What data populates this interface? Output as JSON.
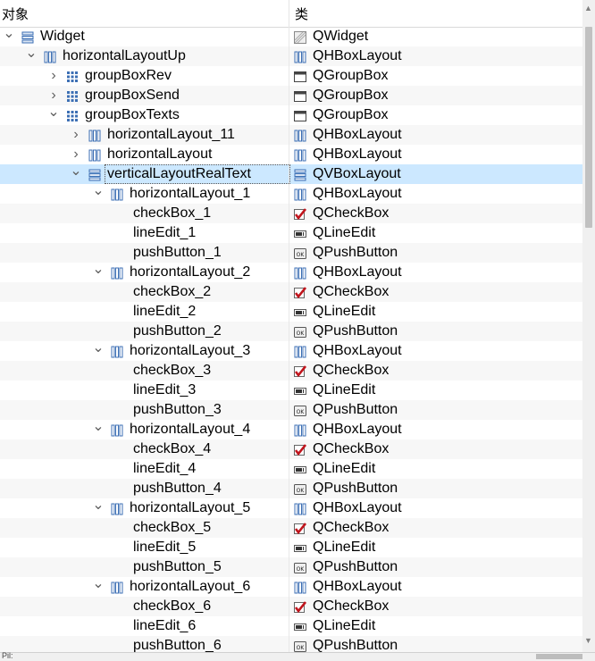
{
  "header": {
    "object_col": "对象",
    "class_col": "类"
  },
  "rows": [
    {
      "name": "Widget",
      "cls": "QWidget",
      "depth": 0,
      "exp": "open",
      "icon": "vbox-layout-icon",
      "cicon": "widget-icon"
    },
    {
      "name": "horizontalLayoutUp",
      "cls": "QHBoxLayout",
      "depth": 1,
      "exp": "open",
      "icon": "hbox-layout-icon",
      "cicon": "hbox-layout-icon"
    },
    {
      "name": "groupBoxRev",
      "cls": "QGroupBox",
      "depth": 2,
      "exp": "closed",
      "icon": "grid-layout-icon",
      "cicon": "groupbox-icon"
    },
    {
      "name": "groupBoxSend",
      "cls": "QGroupBox",
      "depth": 2,
      "exp": "closed",
      "icon": "grid-layout-icon",
      "cicon": "groupbox-icon"
    },
    {
      "name": "groupBoxTexts",
      "cls": "QGroupBox",
      "depth": 2,
      "exp": "open",
      "icon": "grid-layout-icon",
      "cicon": "groupbox-icon"
    },
    {
      "name": "horizontalLayout_11",
      "cls": "QHBoxLayout",
      "depth": 3,
      "exp": "closed",
      "icon": "hbox-layout-icon",
      "cicon": "hbox-layout-icon"
    },
    {
      "name": "horizontalLayout",
      "cls": "QHBoxLayout",
      "depth": 3,
      "exp": "closed",
      "icon": "hbox-layout-icon",
      "cicon": "hbox-layout-icon"
    },
    {
      "name": "verticalLayoutRealText",
      "cls": "QVBoxLayout",
      "depth": 3,
      "exp": "open",
      "icon": "vbox-layout-icon",
      "cicon": "vbox-layout-icon",
      "selected": true
    },
    {
      "name": "horizontalLayout_1",
      "cls": "QHBoxLayout",
      "depth": 4,
      "exp": "open",
      "icon": "hbox-layout-icon",
      "cicon": "hbox-layout-icon"
    },
    {
      "name": "checkBox_1",
      "cls": "QCheckBox",
      "depth": 5,
      "exp": "none",
      "icon": "",
      "cicon": "checkbox-icon"
    },
    {
      "name": "lineEdit_1",
      "cls": "QLineEdit",
      "depth": 5,
      "exp": "none",
      "icon": "",
      "cicon": "lineedit-icon"
    },
    {
      "name": "pushButton_1",
      "cls": "QPushButton",
      "depth": 5,
      "exp": "none",
      "icon": "",
      "cicon": "pushbutton-icon"
    },
    {
      "name": "horizontalLayout_2",
      "cls": "QHBoxLayout",
      "depth": 4,
      "exp": "open",
      "icon": "hbox-layout-icon",
      "cicon": "hbox-layout-icon"
    },
    {
      "name": "checkBox_2",
      "cls": "QCheckBox",
      "depth": 5,
      "exp": "none",
      "icon": "",
      "cicon": "checkbox-icon"
    },
    {
      "name": "lineEdit_2",
      "cls": "QLineEdit",
      "depth": 5,
      "exp": "none",
      "icon": "",
      "cicon": "lineedit-icon"
    },
    {
      "name": "pushButton_2",
      "cls": "QPushButton",
      "depth": 5,
      "exp": "none",
      "icon": "",
      "cicon": "pushbutton-icon"
    },
    {
      "name": "horizontalLayout_3",
      "cls": "QHBoxLayout",
      "depth": 4,
      "exp": "open",
      "icon": "hbox-layout-icon",
      "cicon": "hbox-layout-icon"
    },
    {
      "name": "checkBox_3",
      "cls": "QCheckBox",
      "depth": 5,
      "exp": "none",
      "icon": "",
      "cicon": "checkbox-icon"
    },
    {
      "name": "lineEdit_3",
      "cls": "QLineEdit",
      "depth": 5,
      "exp": "none",
      "icon": "",
      "cicon": "lineedit-icon"
    },
    {
      "name": "pushButton_3",
      "cls": "QPushButton",
      "depth": 5,
      "exp": "none",
      "icon": "",
      "cicon": "pushbutton-icon"
    },
    {
      "name": "horizontalLayout_4",
      "cls": "QHBoxLayout",
      "depth": 4,
      "exp": "open",
      "icon": "hbox-layout-icon",
      "cicon": "hbox-layout-icon"
    },
    {
      "name": "checkBox_4",
      "cls": "QCheckBox",
      "depth": 5,
      "exp": "none",
      "icon": "",
      "cicon": "checkbox-icon"
    },
    {
      "name": "lineEdit_4",
      "cls": "QLineEdit",
      "depth": 5,
      "exp": "none",
      "icon": "",
      "cicon": "lineedit-icon"
    },
    {
      "name": "pushButton_4",
      "cls": "QPushButton",
      "depth": 5,
      "exp": "none",
      "icon": "",
      "cicon": "pushbutton-icon"
    },
    {
      "name": "horizontalLayout_5",
      "cls": "QHBoxLayout",
      "depth": 4,
      "exp": "open",
      "icon": "hbox-layout-icon",
      "cicon": "hbox-layout-icon"
    },
    {
      "name": "checkBox_5",
      "cls": "QCheckBox",
      "depth": 5,
      "exp": "none",
      "icon": "",
      "cicon": "checkbox-icon"
    },
    {
      "name": "lineEdit_5",
      "cls": "QLineEdit",
      "depth": 5,
      "exp": "none",
      "icon": "",
      "cicon": "lineedit-icon"
    },
    {
      "name": "pushButton_5",
      "cls": "QPushButton",
      "depth": 5,
      "exp": "none",
      "icon": "",
      "cicon": "pushbutton-icon"
    },
    {
      "name": "horizontalLayout_6",
      "cls": "QHBoxLayout",
      "depth": 4,
      "exp": "open",
      "icon": "hbox-layout-icon",
      "cicon": "hbox-layout-icon"
    },
    {
      "name": "checkBox_6",
      "cls": "QCheckBox",
      "depth": 5,
      "exp": "none",
      "icon": "",
      "cicon": "checkbox-icon"
    },
    {
      "name": "lineEdit_6",
      "cls": "QLineEdit",
      "depth": 5,
      "exp": "none",
      "icon": "",
      "cicon": "lineedit-icon"
    },
    {
      "name": "pushButton_6",
      "cls": "QPushButton",
      "depth": 5,
      "exp": "none",
      "icon": "",
      "cicon": "pushbutton-icon"
    }
  ],
  "footer": {
    "cut_text": "Pil:"
  },
  "colors": {
    "selection": "#cce8ff",
    "alt_row": "#f7f7f7",
    "layout_icon": "#3c6fb4",
    "checkbox_mark": "#c0141c"
  }
}
